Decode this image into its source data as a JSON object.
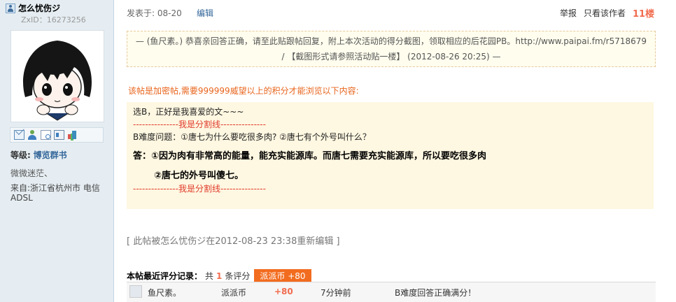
{
  "user": {
    "name": "怎么忧伤ジ",
    "zxid": "ZxID：16273256",
    "level_label": "等级:",
    "level_value": "博览群书",
    "signature": "微微迷茫、",
    "from": "来自:浙江省杭州市 电信ADSL",
    "action_icons": [
      "mail-icon",
      "add-friend-icon",
      "profile-icon",
      "card-icon",
      "apps-icon"
    ]
  },
  "post": {
    "posted_time": "发表于: 08-20",
    "edit_label": "编辑",
    "report_label": "举报",
    "only_author_label": "只看该作者",
    "floor": "11楼",
    "notice_line1": "— (鱼尺素。) 恭喜亲回答正确，请至此贴跟帖回复，附上本次活动的得分截图，领取相应的后花园PB。http://www.paipai.fm/r5718679",
    "notice_line2": "/ 【截图形式请参照活动贴一楼】 (2012-08-26 20:25) —",
    "locked_text": "该帖是加密帖,需要999999威望以上的积分才能浏览以下内容:",
    "content": {
      "line1": "选B，正好是我喜爱的文~~~",
      "divider": "---------------我是分割线---------------",
      "question": "B难度问题：①唐七为什么要吃很多肉? ②唐七有个外号叫什么？",
      "answer1": "答：①因为肉有非常高的能量，能充实能源库。而唐七需要充实能源库，所以要吃很多肉",
      "answer2": "②唐七的外号叫傻七。",
      "divider2": "---------------我是分割线---------------"
    },
    "edited_note": "[ 此帖被怎么忧伤ジ在2012-08-23 23:38重新编辑 ]"
  },
  "rating": {
    "title": "本帖最近评分记录：",
    "count_prefix": "共",
    "count": "1",
    "count_suffix": "条评分",
    "badge": "派派币 +80",
    "rows": [
      {
        "user": "鱼尺素。",
        "currency": "派派币",
        "value": "+80",
        "time": "7分钟前",
        "reason": "B难度回答正确满分！"
      }
    ]
  }
}
